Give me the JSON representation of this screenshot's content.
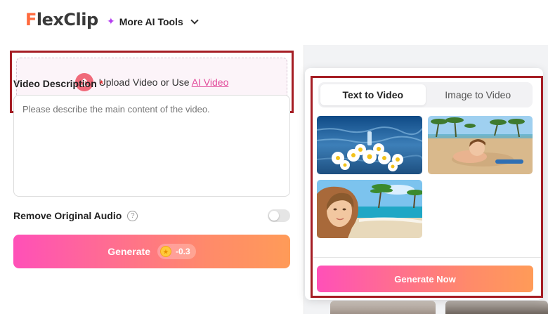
{
  "header": {
    "logo_prefix": "F",
    "logo_rest": "lexClip",
    "ai_tools_label": "More AI Tools"
  },
  "upload": {
    "text": "Upload Video or Use ",
    "ai_link": "AI Video"
  },
  "description": {
    "label": "Video Description",
    "required_mark": "*",
    "placeholder": "Please describe the main content of the video."
  },
  "audio": {
    "label": "Remove Original Audio",
    "help": "?",
    "toggle_on": false
  },
  "generate": {
    "label": "Generate",
    "cost": "-0.3"
  },
  "popup": {
    "tabs": [
      {
        "label": "Text to Video",
        "active": true
      },
      {
        "label": "Image to Video",
        "active": false
      }
    ],
    "thumbnails": [
      {
        "name": "daisies-on-water-thumbnail"
      },
      {
        "name": "girl-on-beach-thumbnail"
      },
      {
        "name": "woman-at-tropical-beach-thumbnail"
      }
    ],
    "generate_now": "Generate Now"
  },
  "colors": {
    "highlight_outline": "#a51d24",
    "gradient_start": "#ff50b8",
    "gradient_end": "#ff9b58",
    "link": "#e24d9c",
    "logo_accent": "#ff6a3d"
  }
}
